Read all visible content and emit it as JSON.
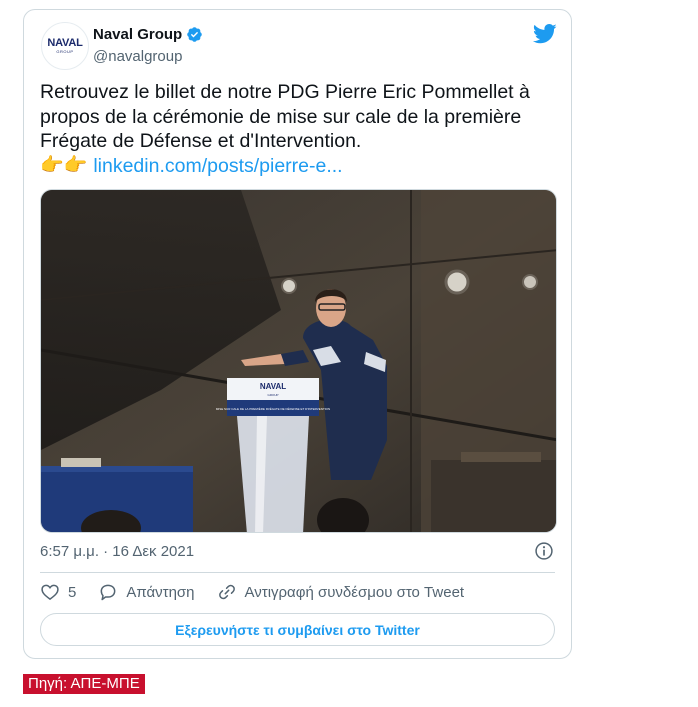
{
  "tweet": {
    "author": {
      "display_name": "Naval Group",
      "handle": "@navalgroup",
      "avatar_logo": "NAVAL",
      "avatar_sub": "GROUP",
      "verified_icon": "verified-badge-icon"
    },
    "platform_icon": "twitter-bird-icon",
    "text_lines": [
      "Retrouvez le billet de notre PDG Pierre Eric Pommellet à",
      "propos de la cérémonie de mise sur cale de la première",
      "Frégate de Défense et d'Intervention."
    ],
    "emoji": "👉👉",
    "link_text": "linkedin.com/posts/pierre-e...",
    "media": {
      "lectern_logo": "NAVAL",
      "lectern_sub": "GROUP",
      "banner_text": "MISE SUR CALE DE LA PREMIÈRE FRÉGATE DE DÉFENSE ET D'INTERVENTION"
    },
    "timestamp": "6:57 μ.μ. · 16 Δεκ 2021",
    "likes_count": "5",
    "reply_label": "Απάντηση",
    "copy_link_label": "Αντιγραφή συνδέσμου στο Tweet",
    "explore_label": "Εξερευνήστε τι συμβαίνει στο Twitter"
  },
  "source_label": "Πηγή: ΑΠΕ-ΜΠΕ",
  "colors": {
    "accent": "#1d9bf0",
    "text": "#0f1419",
    "secondary": "#536471",
    "border": "#cfd9de",
    "source_bg": "#c8102e"
  }
}
